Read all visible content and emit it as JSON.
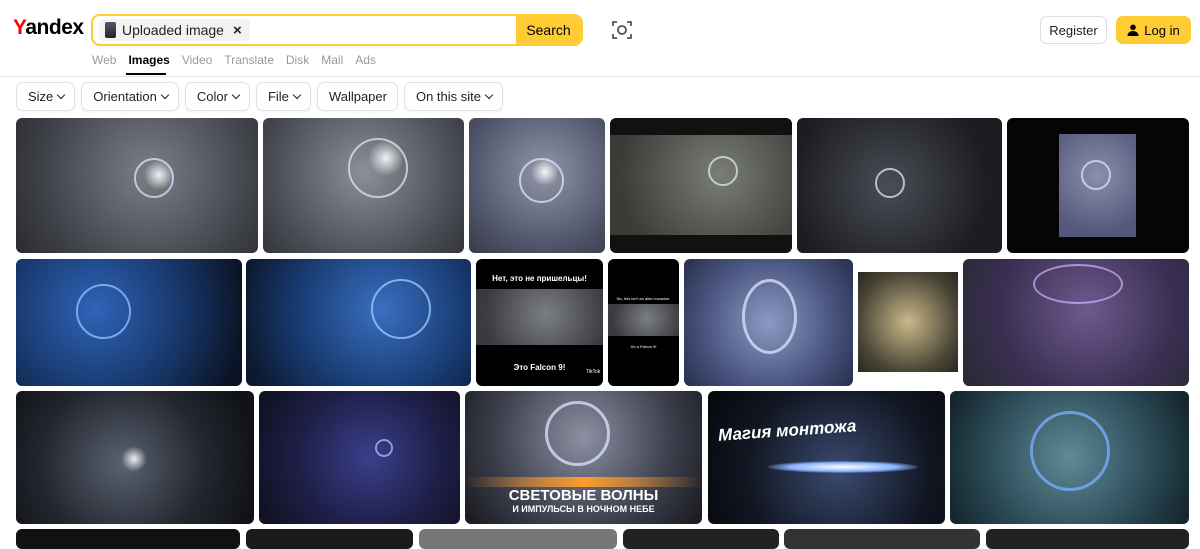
{
  "header": {
    "logo": "Yandex",
    "search_chip_label": "Uploaded image",
    "search_button": "Search",
    "tabs": [
      "Web",
      "Images",
      "Video",
      "Translate",
      "Disk",
      "Mail",
      "Ads"
    ],
    "active_tab": "Images",
    "register": "Register",
    "login": "Log in"
  },
  "filters": [
    "Size",
    "Orientation",
    "Color",
    "File",
    "Wallpaper",
    "On this site"
  ],
  "results": {
    "captions": {
      "ru_top": "Нет, это не пришельцы!",
      "ru_bottom": "Это Falcon 9!",
      "tiktok": "TikTok",
      "en_top": "No, this isn't an alien invasion.",
      "en_bottom": "It's a Falcon 9!",
      "magic": "Магия монтожа",
      "waves_line1": "СВЕТОВЫЕ ВОЛНЫ",
      "waves_line2": "И ИМПУЛЬСЫ В НОЧНОМ НЕБЕ"
    }
  },
  "colors": {
    "accent": "#ffcc33",
    "logo_red": "#ff0000"
  }
}
